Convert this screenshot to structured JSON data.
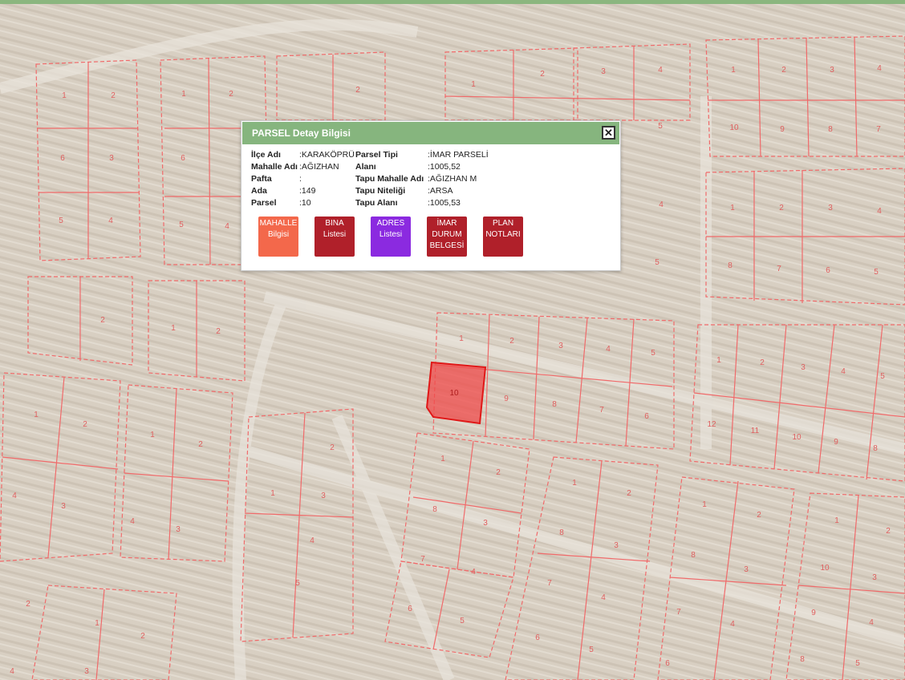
{
  "popup": {
    "title": "PARSEL Detay Bilgisi",
    "close_glyph": "✕",
    "left_fields": [
      {
        "label": "İlçe Adı",
        "value": ":KARAKÖPRÜ"
      },
      {
        "label": "Mahalle Adı",
        "value": ":AĞIZHAN"
      },
      {
        "label": "Pafta",
        "value": ":"
      },
      {
        "label": "Ada",
        "value": ":149"
      },
      {
        "label": "Parsel",
        "value": ":10"
      }
    ],
    "right_fields": [
      {
        "label": "Parsel Tipi",
        "value": ":İMAR PARSELİ"
      },
      {
        "label": "Alanı",
        "value": ":1005,52"
      },
      {
        "label": "Tapu Mahalle Adı",
        "value": ":AĞIZHAN M"
      },
      {
        "label": "Tapu Niteliği",
        "value": ":ARSA"
      },
      {
        "label": "Tapu Alanı",
        "value": ":1005,53"
      }
    ],
    "buttons": [
      {
        "lines": [
          "MAHALLE",
          "Bilgisi"
        ],
        "color": "#f3684b"
      },
      {
        "lines": [
          "BINA",
          "Listesi"
        ],
        "color": "#b0202a"
      },
      {
        "lines": [
          "ADRES",
          "Listesi"
        ],
        "color": "#8b2ae0"
      },
      {
        "lines": [
          "İMAR",
          "DURUM",
          "BELGESİ"
        ],
        "color": "#b0202a"
      },
      {
        "lines": [
          "PLAN",
          "NOTLARI"
        ],
        "color": "#b0202a"
      }
    ]
  },
  "map": {
    "selected_parcel_label": "10",
    "parcel_labels": [
      "1",
      "2",
      "3",
      "4",
      "5",
      "6",
      "7",
      "8",
      "9",
      "10",
      "11",
      "12"
    ],
    "colors": {
      "parcel_line": "#f06a6a",
      "selected_fill": "#f04a4a",
      "background": "#d9d0c3"
    }
  }
}
